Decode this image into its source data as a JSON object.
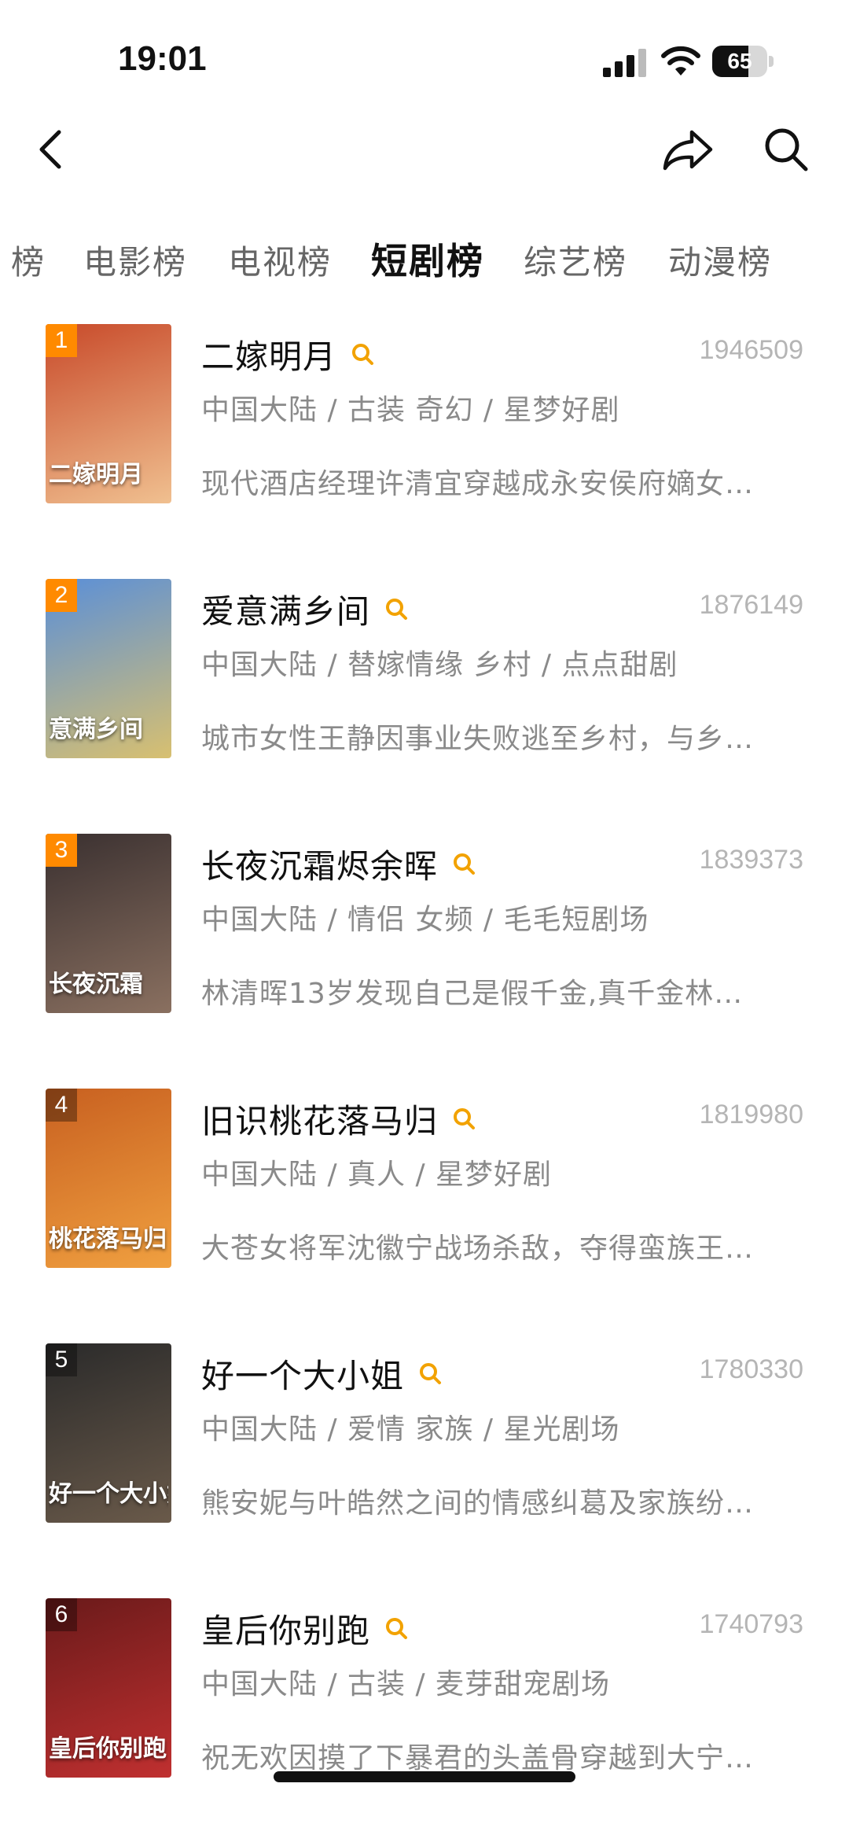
{
  "status": {
    "time": "19:01",
    "battery": "65",
    "battery_level": 0.65
  },
  "nav": {
    "back_icon": "chevron-left-icon",
    "share_icon": "share-icon",
    "search_icon": "search-icon"
  },
  "tabs": [
    {
      "label": "榜"
    },
    {
      "label": "电影榜"
    },
    {
      "label": "电视榜"
    },
    {
      "label": "短剧榜",
      "active": true
    },
    {
      "label": "综艺榜"
    },
    {
      "label": "动漫榜"
    }
  ],
  "items": [
    {
      "rank": "1",
      "title": "二嫁明月",
      "score": "1946509",
      "meta": "中国大陆 / 古装 奇幻 / 星梦好剧",
      "desc": "现代酒店经理许清宜穿越成永安侯府嫡女…",
      "poster_text": "二嫁明月",
      "poster_colors": [
        "#c84a2a",
        "#f0c090"
      ]
    },
    {
      "rank": "2",
      "title": "爱意满乡间",
      "score": "1876149",
      "meta": "中国大陆 / 替嫁情缘 乡村 / 点点甜剧",
      "desc": "城市女性王静因事业失败逃至乡村，与乡…",
      "poster_text": "意满乡间",
      "poster_colors": [
        "#5a8fd8",
        "#d8c070"
      ]
    },
    {
      "rank": "3",
      "title": "长夜沉霜烬余晖",
      "score": "1839373",
      "meta": "中国大陆 / 情侣 女频 / 毛毛短剧场",
      "desc": "林清晖13岁发现自己是假千金,真千金林…",
      "poster_text": "长夜沉霜",
      "poster_colors": [
        "#3a3030",
        "#8a7060"
      ]
    },
    {
      "rank": "4",
      "title": "旧识桃花落马归",
      "score": "1819980",
      "meta": "中国大陆 / 真人 / 星梦好剧",
      "desc": "大苍女将军沈徽宁战场杀敌，夺得蛮族王…",
      "poster_text": "桃花落马归",
      "poster_colors": [
        "#c86020",
        "#f0a040"
      ]
    },
    {
      "rank": "5",
      "title": "好一个大小姐",
      "score": "1780330",
      "meta": "中国大陆 / 爱情 家族 / 星光剧场",
      "desc": "熊安妮与叶皓然之间的情感纠葛及家族纷…",
      "poster_text": "好一个大小姐",
      "poster_colors": [
        "#2a2a2a",
        "#6a5a4a"
      ]
    },
    {
      "rank": "6",
      "title": "皇后你别跑",
      "score": "1740793",
      "meta": "中国大陆 / 古装 / 麦芽甜宠剧场",
      "desc": "祝无欢因摸了下暴君的头盖骨穿越到大宁…",
      "poster_text": "皇后你别跑",
      "poster_colors": [
        "#6a1a1a",
        "#c03030"
      ]
    }
  ]
}
